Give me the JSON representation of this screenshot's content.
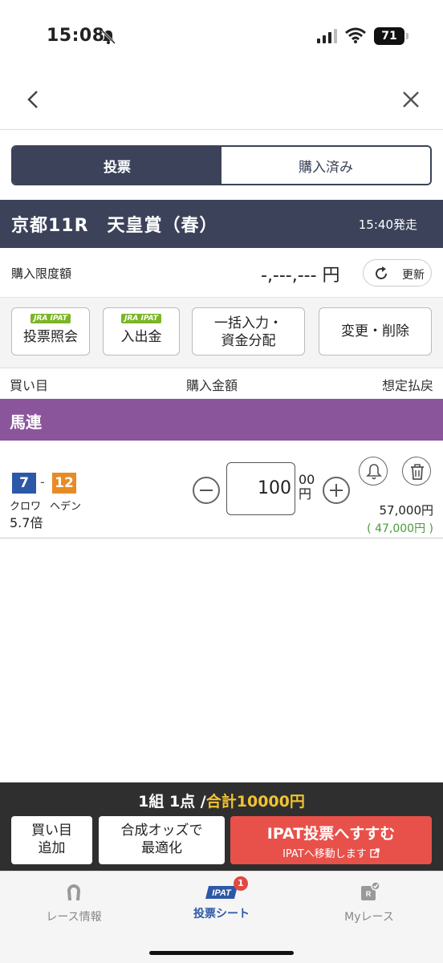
{
  "status_bar": {
    "time": "15:08",
    "battery": "71"
  },
  "segment": {
    "tab_vote": "投票",
    "tab_purchased": "購入済み"
  },
  "race": {
    "name": "京都11R　天皇賞（春）",
    "post_time": "15:40発走"
  },
  "limit": {
    "label": "購入限度額",
    "amount": "-,---,--- 円",
    "refresh_label": "更新"
  },
  "tools": {
    "ipat_badge": "JRA IPAT",
    "vote_inquiry": "投票照会",
    "deposit": "入出金",
    "bulk_line1": "一括入力・",
    "bulk_line2": "資金分配",
    "edit_delete": "変更・削除"
  },
  "columns": {
    "bet": "買い目",
    "amount": "購入金額",
    "payout": "想定払戻"
  },
  "bet_type": "馬連",
  "bet": {
    "horse1_num": "7",
    "horse2_num": "12",
    "separator": "-",
    "horse1_name": "クロワ",
    "horse2_name": "ヘデン",
    "odds": "5.7倍",
    "amount": "100",
    "unit_line1": "00",
    "unit_line2": "円",
    "payout": "57,000円",
    "payout_sub_open": "(",
    "payout_sub_value": "47,000円",
    "payout_sub_close": ")"
  },
  "summary": {
    "prefix": "1組 1点 /",
    "total": "合計10000円"
  },
  "actions": {
    "add_line1": "買い目",
    "add_line2": "追加",
    "opt_line1": "合成オッズで",
    "opt_line2": "最適化",
    "ipat_title": "IPAT投票へすすむ",
    "ipat_sub": "IPATへ移動します"
  },
  "tabs": {
    "race_info": "レース情報",
    "vote_sheet": "投票シート",
    "vote_sheet_badge": "1",
    "vote_sheet_icon_text": "IPAT",
    "my_race": "Myレース",
    "my_race_icon_text": "R"
  },
  "colors": {
    "navy": "#3b4259",
    "purple": "#8b559b",
    "horse7": "#2d58a8",
    "horse12": "#e88b24",
    "green": "#4a9a3a",
    "red": "#e8514a",
    "gold": "#f1c232"
  }
}
